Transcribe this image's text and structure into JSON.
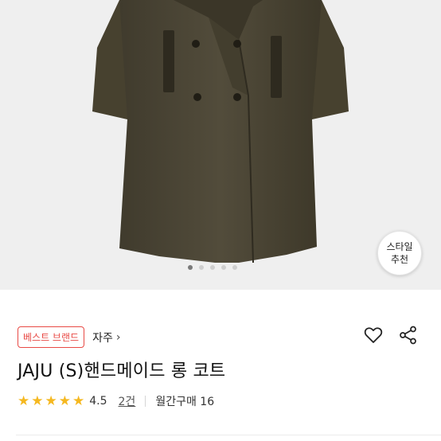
{
  "hero": {
    "style_button": {
      "line1": "스타일",
      "line2": "추천"
    },
    "carousel": {
      "count": 5,
      "active_index": 0
    }
  },
  "product": {
    "badge": "베스트 브랜드",
    "brand": "자주",
    "brand_chevron": "›",
    "title": "JAJU (S)핸드메이드 롱 코트",
    "rating": {
      "stars": 5,
      "score": "4.5",
      "reviews": "2건",
      "monthly": "월간구매 16"
    }
  },
  "icons": {
    "like": "heart-icon",
    "share": "share-icon"
  },
  "colors": {
    "badge": "#e84a45",
    "star": "#f5b820",
    "coat": "#4b4634"
  }
}
